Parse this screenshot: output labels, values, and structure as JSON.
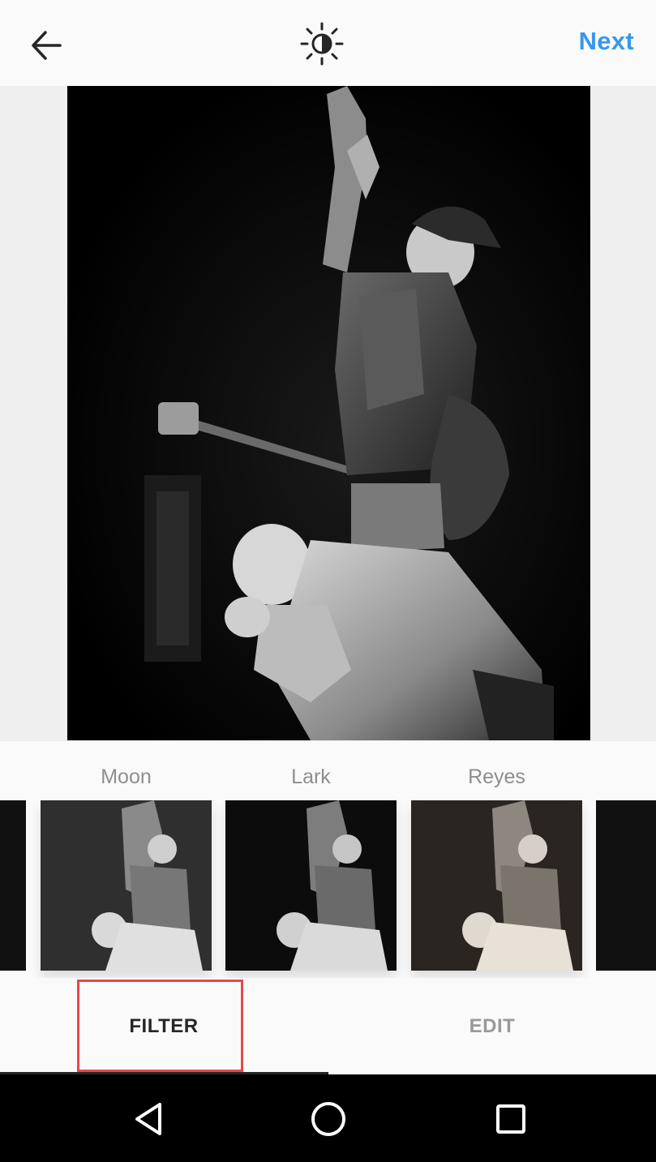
{
  "header": {
    "next_label": "Next",
    "back_icon": "arrow-left-icon",
    "lux_icon": "brightness-icon"
  },
  "filters": [
    {
      "name": "Moon"
    },
    {
      "name": "Lark"
    },
    {
      "name": "Reyes"
    }
  ],
  "tabs": {
    "filter_label": "FILTER",
    "edit_label": "EDIT",
    "active": "FILTER"
  },
  "colors": {
    "accent": "#3897f0",
    "highlight": "#e8474a",
    "navbar": "#000000"
  },
  "system_nav": {
    "back_icon": "triangle-back-icon",
    "home_icon": "circle-home-icon",
    "recents_icon": "square-recents-icon"
  }
}
